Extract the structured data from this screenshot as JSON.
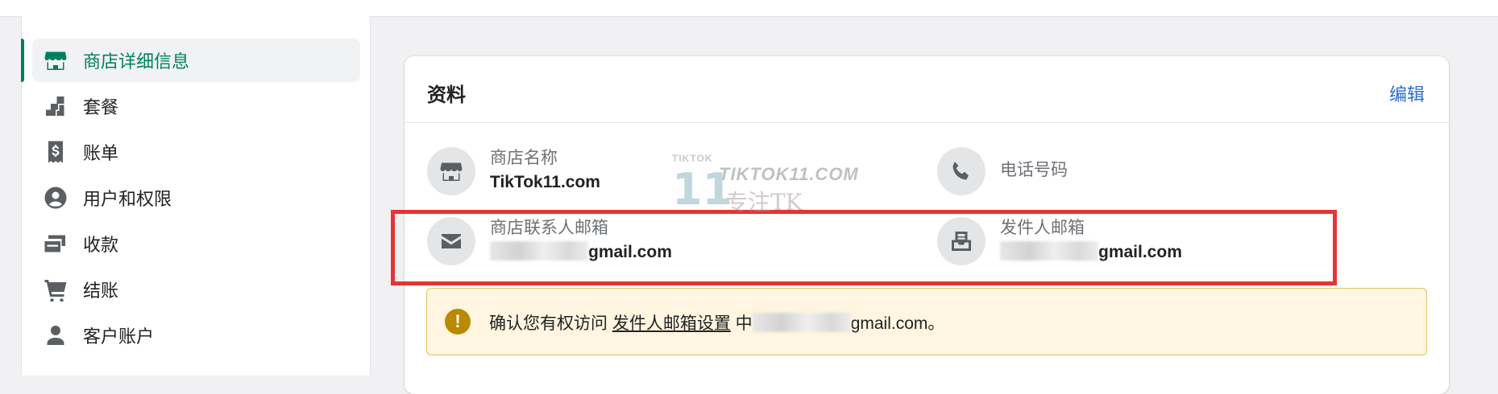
{
  "sidebar": {
    "items": [
      {
        "label": "商店详细信息",
        "icon": "store-icon",
        "active": true
      },
      {
        "label": "套餐",
        "icon": "plan-icon"
      },
      {
        "label": "账单",
        "icon": "receipt-icon"
      },
      {
        "label": "用户和权限",
        "icon": "user-circle-icon"
      },
      {
        "label": "收款",
        "icon": "payment-icon"
      },
      {
        "label": "结账",
        "icon": "cart-icon"
      },
      {
        "label": "客户账户",
        "icon": "person-icon"
      }
    ]
  },
  "card": {
    "title": "资料",
    "edit_label": "编辑",
    "fields": {
      "store_name": {
        "label": "商店名称",
        "value": "TikTok11.com",
        "icon": "store-icon"
      },
      "phone": {
        "label": "电话号码",
        "icon": "phone-icon"
      },
      "contact_email": {
        "label": "商店联系人邮箱",
        "value_suffix": "gmail.com",
        "icon": "mail-icon"
      },
      "sender_email": {
        "label": "发件人邮箱",
        "value_suffix": "gmail.com",
        "icon": "mail-inbox-icon"
      }
    },
    "banner": {
      "icon": "alert-icon",
      "icon_glyph": "!",
      "text_before": "确认您有权访问 ",
      "link": "发件人邮箱设置",
      "text_mid": " 中",
      "text_after": "gmail.com。"
    }
  },
  "watermark": {
    "small": "TIKTOK",
    "number": "11",
    "brand": "TIKTOK11.COM",
    "sub": "专注TK"
  },
  "colors": {
    "accent": "#008060",
    "link": "#2c6ecb",
    "highlight": "#e73434",
    "banner_bg": "#fff5e0",
    "warning": "#b98900"
  }
}
